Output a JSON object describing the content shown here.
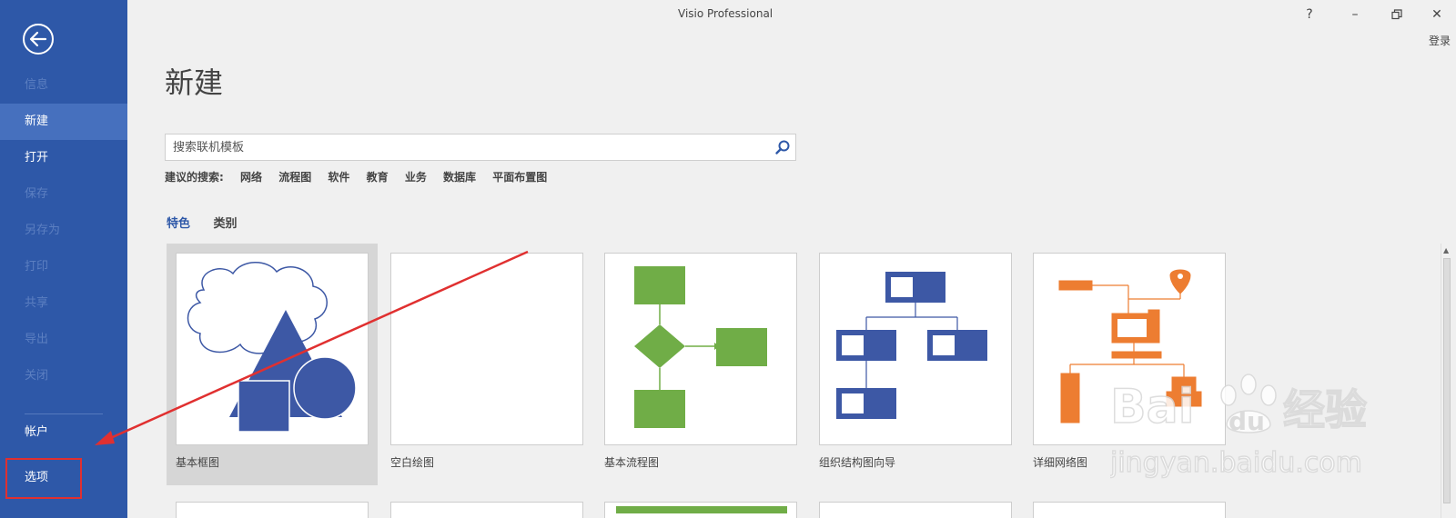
{
  "window": {
    "title": "Visio Professional",
    "help": "?",
    "minimize": "–",
    "restore": "🗗",
    "close": "✕",
    "login": "登录"
  },
  "sidebar": {
    "back_icon": "back-arrow-icon",
    "items": [
      {
        "label": "信息",
        "state": "disabled"
      },
      {
        "label": "新建",
        "state": "selected"
      },
      {
        "label": "打开",
        "state": "enabled"
      },
      {
        "label": "保存",
        "state": "disabled"
      },
      {
        "label": "另存为",
        "state": "disabled"
      },
      {
        "label": "打印",
        "state": "disabled"
      },
      {
        "label": "共享",
        "state": "disabled"
      },
      {
        "label": "导出",
        "state": "disabled"
      },
      {
        "label": "关闭",
        "state": "disabled"
      },
      {
        "label": "帐户",
        "state": "enabled"
      },
      {
        "label": "选项",
        "state": "enabled"
      }
    ]
  },
  "main": {
    "title": "新建",
    "search": {
      "placeholder": "搜索联机模板",
      "value": ""
    },
    "suggested_label": "建议的搜索:",
    "suggested": [
      "网络",
      "流程图",
      "软件",
      "教育",
      "业务",
      "数据库",
      "平面布置图"
    ],
    "tabs": [
      {
        "label": "特色",
        "active": true
      },
      {
        "label": "类别",
        "active": false
      }
    ],
    "templates": [
      {
        "label": "基本框图",
        "selected": true
      },
      {
        "label": "空白绘图",
        "selected": false
      },
      {
        "label": "基本流程图",
        "selected": false
      },
      {
        "label": "组织结构图向导",
        "selected": false
      },
      {
        "label": "详细网络图",
        "selected": false
      }
    ]
  },
  "watermark": {
    "brand": "Bai",
    "brand2": "du",
    "cn": "经验",
    "url": "jingyan.baidu.com"
  },
  "colors": {
    "sidebar": "#2e58a8",
    "selected": "#4670be",
    "accent_blue": "#3d58a5",
    "green": "#70ad47",
    "orange": "#ed7d31",
    "annotation_red": "#e03030"
  }
}
